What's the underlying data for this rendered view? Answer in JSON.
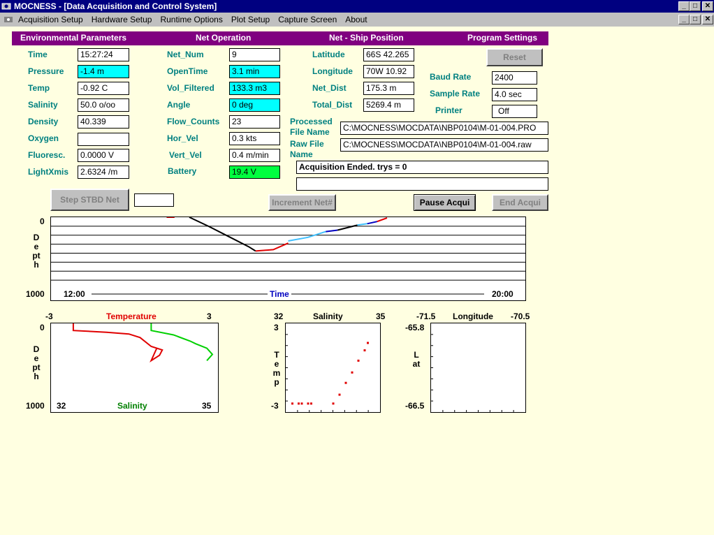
{
  "window": {
    "title": "MOCNESS - [Data Acquisition and Control System]",
    "buttons": [
      "_",
      "□",
      "✕"
    ]
  },
  "menu": {
    "items": [
      "Acquisition Setup",
      "Hardware Setup",
      "Runtime Options",
      "Plot Setup",
      "Capture Screen",
      "About"
    ]
  },
  "headers": {
    "env": "Environmental Parameters",
    "net": "Net Operation",
    "pos": "Net - Ship Position",
    "prog": "Program Settings"
  },
  "env": {
    "time": {
      "label": "Time",
      "value": "15:27:24"
    },
    "pressure": {
      "label": "Pressure",
      "value": "-1.4 m"
    },
    "temp": {
      "label": "Temp",
      "value": "-0.92 C"
    },
    "salinity": {
      "label": "Salinity",
      "value": "50.0 o/oo"
    },
    "density": {
      "label": "Density",
      "value": "40.339"
    },
    "oxygen": {
      "label": "Oxygen",
      "value": ""
    },
    "fluoresc": {
      "label": "Fluoresc.",
      "value": "0.0000 V"
    },
    "lightxmis": {
      "label": "LightXmis",
      "value": "2.6324 /m"
    }
  },
  "net": {
    "net_num": {
      "label": "Net_Num",
      "value": "9"
    },
    "opentime": {
      "label": "OpenTime",
      "value": "3.1 min"
    },
    "vol_filtered": {
      "label": "Vol_Filtered",
      "value": "133.3 m3"
    },
    "angle": {
      "label": "Angle",
      "value": "0 deg"
    },
    "flow_counts": {
      "label": "Flow_Counts",
      "value": "23"
    },
    "hor_vel": {
      "label": "Hor_Vel",
      "value": "0.3 kts"
    },
    "vert_vel": {
      "label": "Vert_Vel",
      "value": "0.4 m/min"
    },
    "battery": {
      "label": "Battery",
      "value": "19.4 V"
    }
  },
  "pos": {
    "latitude": {
      "label": "Latitude",
      "value": "66S 42.265"
    },
    "longitude": {
      "label": "Longitude",
      "value": "70W 10.92"
    },
    "net_dist": {
      "label": "Net_Dist",
      "value": "175.3 m"
    },
    "total_dist": {
      "label": "Total_Dist",
      "value": "5269.4 m"
    },
    "processed_label": "Processed File Name",
    "processed_value": "C:\\MOCNESS\\MOCDATA\\NBP0104\\M-01-004.PRO",
    "raw_label": "Raw File Name",
    "raw_value": "C:\\MOCNESS\\MOCDATA\\NBP0104\\M-01-004.raw",
    "status": "Acquisition Ended. trys = 0",
    "status2": ""
  },
  "prog": {
    "reset": "Reset",
    "baud": {
      "label": "Baud Rate",
      "value": "2400"
    },
    "sample": {
      "label": "Sample Rate",
      "value": "4.0 sec"
    },
    "printer": {
      "label": "Printer",
      "value": "Off"
    }
  },
  "buttons": {
    "step_stbd": "Step STBD Net",
    "step_value": "",
    "increment": "Increment Net#",
    "pause": "Pause Acqui",
    "end": "End Acqui"
  },
  "colors": {
    "title": "#000080",
    "header": "#800080",
    "label": "#008080",
    "cyan": "#00ffff",
    "green": "#00ff40",
    "background": "#ffffe1"
  },
  "chart_data": [
    {
      "type": "line",
      "ylabel": "Depth",
      "xlabel": "Time",
      "y_top_label": "0",
      "y_bottom_label": "1000",
      "x_left_label": "12:00",
      "x_right_label": "20:00",
      "ylim": [
        0,
        1000
      ],
      "xlim": [
        "12:00",
        "20:00"
      ],
      "grid": true,
      "series": [
        {
          "color": "#e00000",
          "x": [
            "13:57",
            "14:05"
          ],
          "y": [
            0,
            0
          ]
        },
        {
          "color": "#000000",
          "x": [
            "14:20",
            "14:40",
            "15:00",
            "15:20",
            "15:27"
          ],
          "y": [
            0,
            130,
            270,
            410,
            470
          ]
        },
        {
          "color": "#e00000",
          "x": [
            "15:27",
            "15:45",
            "16:00"
          ],
          "y": [
            470,
            450,
            360
          ]
        },
        {
          "color": "#40c0ff",
          "x": [
            "16:00",
            "16:20",
            "16:38"
          ],
          "y": [
            330,
            280,
            200
          ]
        },
        {
          "color": "#0000c0",
          "x": [
            "16:38",
            "16:50"
          ],
          "y": [
            200,
            180
          ]
        },
        {
          "color": "#000000",
          "x": [
            "16:50",
            "17:10"
          ],
          "y": [
            180,
            110
          ]
        },
        {
          "color": "#40c0ff",
          "x": [
            "17:10",
            "17:20"
          ],
          "y": [
            110,
            90
          ]
        },
        {
          "color": "#0000c0",
          "x": [
            "17:20",
            "17:30"
          ],
          "y": [
            90,
            60
          ]
        },
        {
          "color": "#e00000",
          "x": [
            "17:30",
            "17:40"
          ],
          "y": [
            60,
            10
          ]
        }
      ]
    },
    {
      "type": "line",
      "title": "Temperature",
      "ylabel": "Depth",
      "xlabel": "Salinity",
      "x_top_left": "-3",
      "x_top_right": "3",
      "x_bottom_left": "32",
      "x_bottom_right": "35",
      "y_top_label": "0",
      "y_bottom_label": "1000",
      "xlim_temperature": [
        -3,
        3
      ],
      "xlim_salinity": [
        32,
        35
      ],
      "ylim": [
        0,
        1000
      ],
      "series": [
        {
          "color": "#e00000",
          "name": "Temperature",
          "x": [
            -2.2,
            -2.2,
            -1.0,
            -0.2,
            0.2,
            0.6,
            1.0,
            0.9,
            0.6,
            0.7,
            0.8
          ],
          "y": [
            0,
            80,
            100,
            120,
            160,
            260,
            300,
            360,
            420,
            350,
            280
          ]
        },
        {
          "color": "#00d000",
          "name": "Salinity",
          "x": [
            33.8,
            33.8,
            34.2,
            34.5,
            34.6,
            34.8,
            34.9,
            34.8
          ],
          "y": [
            0,
            80,
            130,
            200,
            230,
            280,
            350,
            420
          ]
        }
      ]
    },
    {
      "type": "scatter",
      "title": "Salinity",
      "ylabel": "Temp",
      "x_left_label": "32",
      "x_right_label": "35",
      "y_top_label": "3",
      "y_bottom_label": "-3",
      "xlim": [
        32,
        35
      ],
      "ylim": [
        -3,
        3
      ],
      "series": [
        {
          "color": "#e00000",
          "x": [
            32.2,
            32.4,
            32.5,
            32.7,
            32.8,
            33.5,
            33.7,
            33.9,
            34.1,
            34.3,
            34.5,
            34.6
          ],
          "y": [
            -2.4,
            -2.4,
            -2.4,
            -2.4,
            -2.4,
            -2.4,
            -1.8,
            -1.0,
            -0.3,
            0.5,
            1.2,
            1.7
          ]
        }
      ]
    },
    {
      "type": "scatter",
      "title": "Longitude",
      "ylabel": "Lat",
      "x_left_label": "-71.5",
      "x_right_label": "-70.5",
      "y_top_label": "-65.8",
      "y_bottom_label": "-66.5",
      "xlim": [
        -71.5,
        -70.5
      ],
      "ylim": [
        -66.5,
        -65.8
      ],
      "series": []
    }
  ]
}
